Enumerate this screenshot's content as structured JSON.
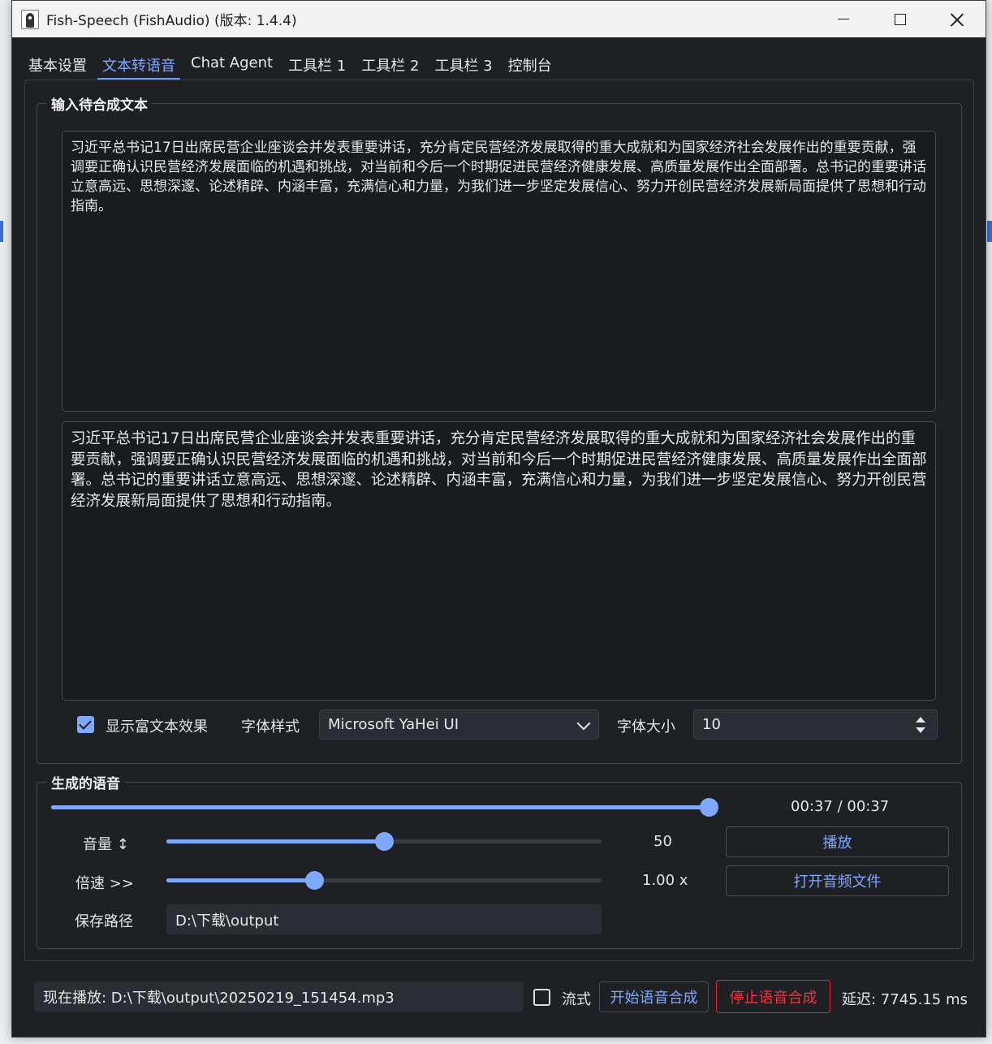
{
  "window": {
    "title": "Fish-Speech (FishAudio) (版本: 1.4.4)"
  },
  "tabs": [
    {
      "label": "基本设置"
    },
    {
      "label": "文本转语音"
    },
    {
      "label": "Chat Agent"
    },
    {
      "label": "工具栏 1"
    },
    {
      "label": "工具栏 2"
    },
    {
      "label": "工具栏 3"
    },
    {
      "label": "控制台"
    }
  ],
  "input_group": {
    "title": "输入待合成文本",
    "source_text": "习近平总书记17日出席民营企业座谈会并发表重要讲话，充分肯定民营经济发展取得的重大成就和为国家经济社会发展作出的重要贡献，强调要正确认识民营经济发展面临的机遇和挑战，对当前和今后一个时期促进民营经济健康发展、高质量发展作出全面部署。总书记的重要讲话立意高远、思想深邃、论述精辟、内涵丰富，充满信心和力量，为我们进一步坚定发展信心、努力开创民营经济发展新局面提供了思想和行动指南。",
    "preview_text": "习近平总书记17日出席民营企业座谈会并发表重要讲话，充分肯定民营经济发展取得的重大成就和为国家经济社会发展作出的重要贡献，强调要正确认识民营经济发展面临的机遇和挑战，对当前和今后一个时期促进民营经济健康发展、高质量发展作出全面部署。总书记的重要讲话立意高远、思想深邃、论述精辟、内涵丰富，充满信心和力量，为我们进一步坚定发展信心、努力开创民营经济发展新局面提供了思想和行动指南。",
    "rich_text_label": "显示富文本效果",
    "rich_text_checked": true,
    "font_style_label": "字体样式",
    "font_style_value": "Microsoft YaHei UI",
    "font_size_label": "字体大小",
    "font_size_value": "10"
  },
  "output_group": {
    "title": "生成的语音",
    "progress_fraction": 1.0,
    "time_display": "00:37 / 00:37",
    "volume_label": "音量 ↕",
    "volume_value": "50",
    "volume_fraction": 0.5,
    "speed_label": "倍速 >>",
    "speed_value": "1.00 x",
    "speed_fraction": 0.34,
    "play_label": "播放",
    "open_file_label": "打开音频文件",
    "save_path_label": "保存路径",
    "save_path_value": "D:\\下载\\output"
  },
  "footer": {
    "now_playing": "现在播放: D:\\下载\\output\\20250219_151454.mp3",
    "stream_label": "流式",
    "stream_checked": false,
    "start_label": "开始语音合成",
    "stop_label": "停止语音合成",
    "latency": "延迟: 7745.15 ms"
  },
  "colors": {
    "accent": "#7fa8ff",
    "danger": "#ef3340",
    "window_bg": "#1f2023"
  }
}
